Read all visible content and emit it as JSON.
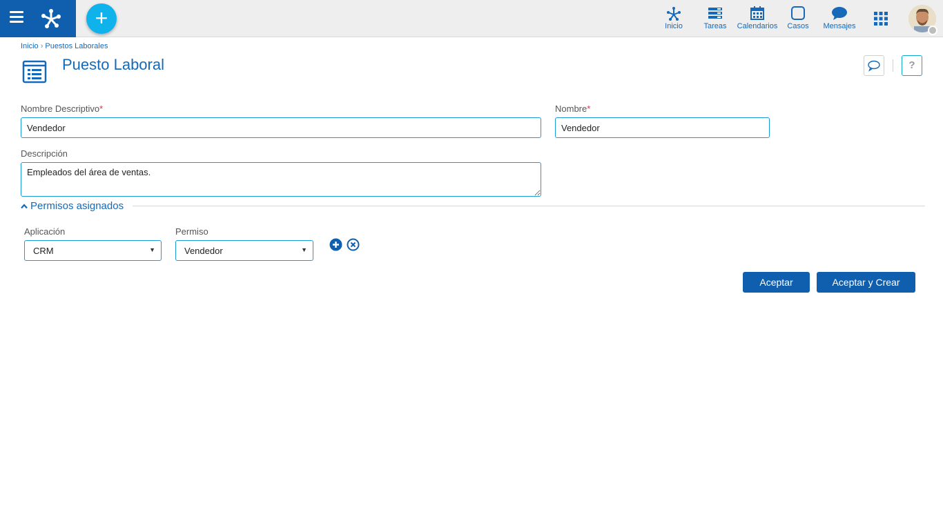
{
  "nav": {
    "items": [
      {
        "label": "Inicio",
        "icon": "home-network-icon"
      },
      {
        "label": "Tareas",
        "icon": "tasks-icon"
      },
      {
        "label": "Calendarios",
        "icon": "calendar-icon"
      },
      {
        "label": "Casos",
        "icon": "cases-icon"
      },
      {
        "label": "Mensajes",
        "icon": "messages-icon"
      }
    ]
  },
  "breadcrumb": {
    "home": "Inicio",
    "current": "Puestos Laborales"
  },
  "page": {
    "title": "Puesto Laboral"
  },
  "form": {
    "nombre_descriptivo": {
      "label": "Nombre Descriptivo",
      "required": "*",
      "value": "Vendedor"
    },
    "nombre": {
      "label": "Nombre",
      "required": "*",
      "value": "Vendedor"
    },
    "descripcion": {
      "label": "Descripción",
      "value": "Empleados del área de ventas."
    }
  },
  "permisos": {
    "section_title": "Permisos asignados",
    "aplicacion": {
      "label": "Aplicación",
      "value": "CRM"
    },
    "permiso": {
      "label": "Permiso",
      "value": "Vendedor"
    }
  },
  "actions": {
    "accept": "Aceptar",
    "accept_create": "Aceptar y Crear"
  },
  "help": {
    "label": "?"
  },
  "colors": {
    "brand": "#0f5fae",
    "accent": "#0fb2ea",
    "link": "#1668b8"
  }
}
